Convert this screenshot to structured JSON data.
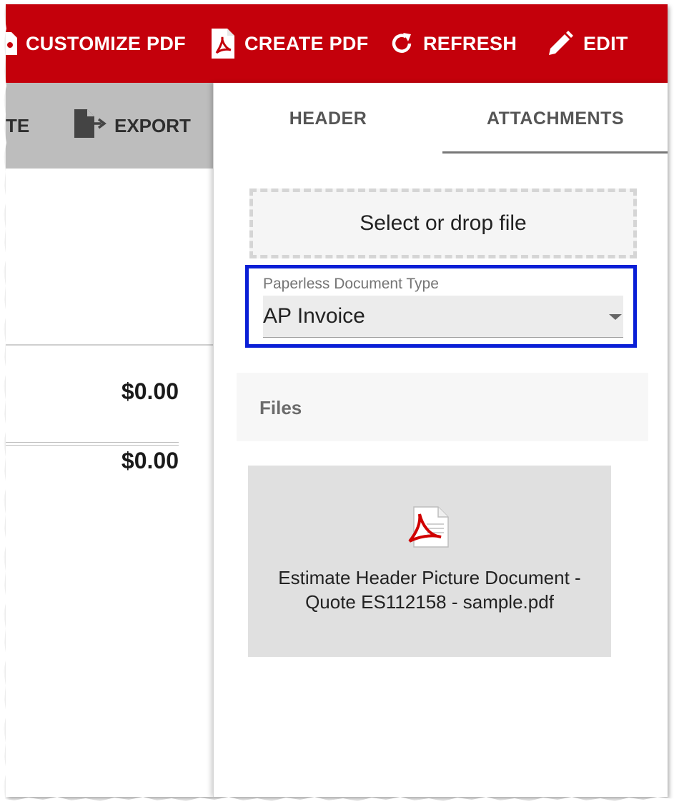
{
  "toolbar": {
    "customize_pdf": "CUSTOMIZE PDF",
    "create_pdf": "CREATE PDF",
    "refresh": "REFRESH",
    "edit": "EDIT",
    "background_color": "#c4000b"
  },
  "left_tools": {
    "truncated_label": "TE",
    "export": "EXPORT"
  },
  "totals": {
    "amount_1": "$0.00",
    "amount_2": "$0.00"
  },
  "tabs": [
    {
      "label": "HEADER",
      "active": false
    },
    {
      "label": "ATTACHMENTS",
      "active": true
    }
  ],
  "dropzone": {
    "label": "Select or drop file"
  },
  "paperless_type": {
    "label": "Paperless Document Type",
    "value": "AP Invoice",
    "highlight_color": "#0a1fd6"
  },
  "files": {
    "heading": "Files",
    "items": [
      {
        "icon": "pdf-file-icon",
        "name_line1": "Estimate Header Picture Document -",
        "name_line2": "Quote ES112158 - sample.pdf"
      }
    ]
  }
}
